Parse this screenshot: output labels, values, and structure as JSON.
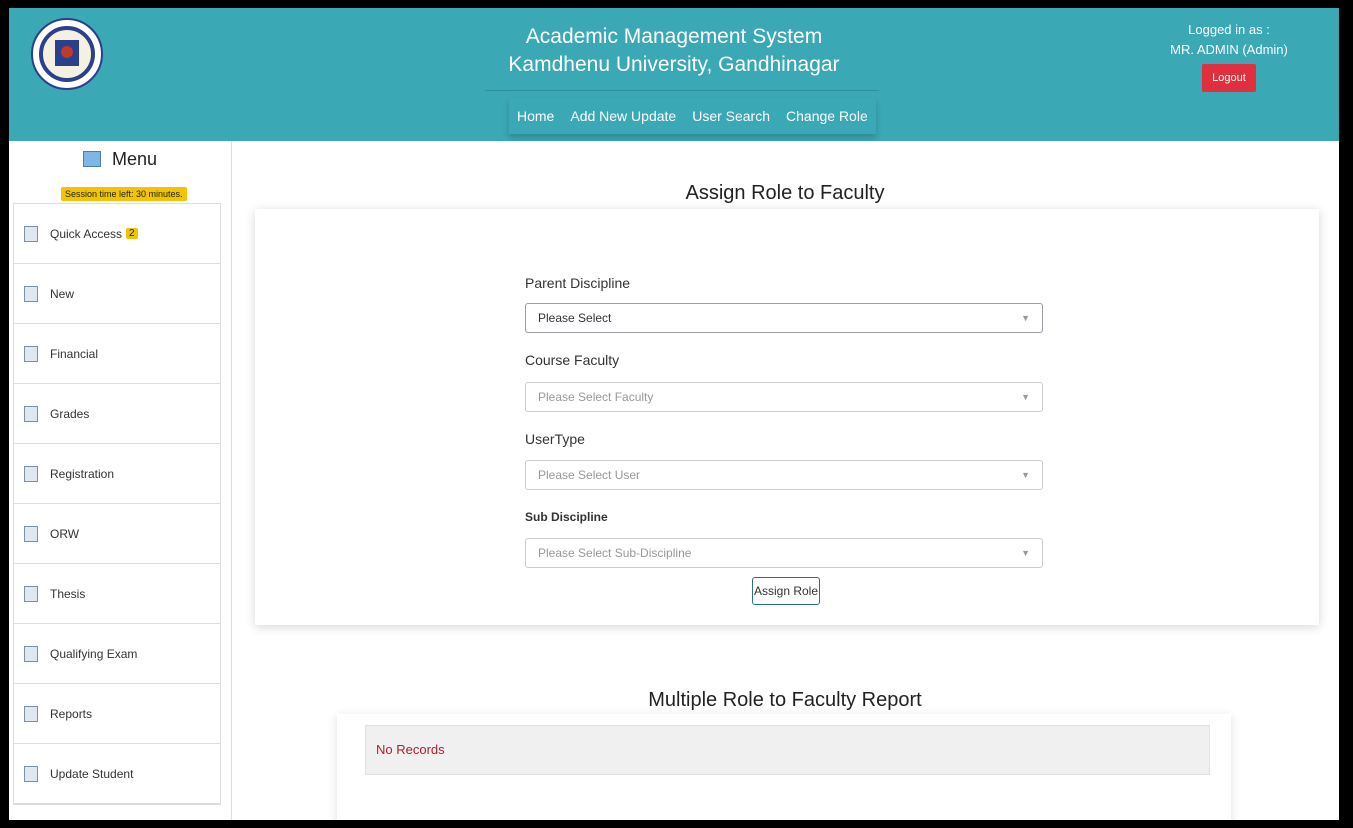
{
  "header": {
    "title_line1": "Academic Management System",
    "title_line2": "Kamdhenu University, Gandhinagar",
    "nav": [
      "Home",
      "Add New Update",
      "User Search",
      "Change Role"
    ],
    "logged_in_label": "Logged in as :",
    "user_name": "MR. ADMIN (Admin)",
    "logout_label": "Logout"
  },
  "sidebar": {
    "menu_label": "Menu",
    "session_text": "Session time left: 30 minutes.",
    "items": [
      {
        "label": "Quick Access",
        "badge": "2",
        "icon": "quick-access-icon"
      },
      {
        "label": "New",
        "icon": "new-icon"
      },
      {
        "label": "Financial",
        "icon": "financial-icon"
      },
      {
        "label": "Grades",
        "icon": "grades-icon"
      },
      {
        "label": "Registration",
        "icon": "registration-icon"
      },
      {
        "label": "ORW",
        "icon": "orw-icon"
      },
      {
        "label": "Thesis",
        "icon": "thesis-icon"
      },
      {
        "label": "Qualifying Exam",
        "icon": "qualifying-exam-icon"
      },
      {
        "label": "Reports",
        "icon": "reports-icon"
      },
      {
        "label": "Update Student",
        "icon": "update-student-icon"
      }
    ]
  },
  "form": {
    "title": "Assign Role to Faculty",
    "parent_discipline_label": "Parent Discipline",
    "parent_discipline_value": "Please Select",
    "course_faculty_label": "Course Faculty",
    "course_faculty_placeholder": "Please Select Faculty",
    "user_type_label": "UserType",
    "user_type_placeholder": "Please Select User",
    "sub_discipline_label": "Sub Discipline",
    "sub_discipline_placeholder": "Please Select Sub-Discipline",
    "assign_button": "Assign Role"
  },
  "report": {
    "title": "Multiple Role to Faculty Report",
    "empty_text": "No Records"
  },
  "colors": {
    "header_bg": "#3aa8b5",
    "logout_bg": "#e03040",
    "badge_bg": "#f2c400",
    "no_records_text": "#b02030"
  }
}
